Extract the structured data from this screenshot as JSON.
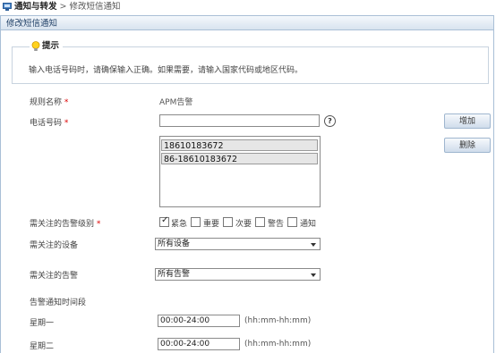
{
  "breadcrumb": {
    "root": "通知与转发",
    "separator": " > ",
    "current": "修改短信通知"
  },
  "panel": {
    "title": "修改短信通知"
  },
  "tip": {
    "title": "提示",
    "text": "输入电话号码时，请确保输入正确。如果需要，请输入国家代码或地区代码。"
  },
  "form": {
    "rule_name": {
      "label": "规则名称",
      "required": "*",
      "value": "APM告警"
    },
    "phone": {
      "label": "电话号码",
      "required": "*",
      "value": "",
      "help": "?"
    },
    "phone_list": [
      "18610183672",
      "86-18610183672"
    ],
    "buttons": {
      "add": "增加",
      "delete": "删除"
    },
    "severity": {
      "label": "需关注的告警级别",
      "required": "*",
      "options": [
        {
          "label": "紧急",
          "checked": true
        },
        {
          "label": "重要",
          "checked": false
        },
        {
          "label": "次要",
          "checked": false
        },
        {
          "label": "警告",
          "checked": false
        },
        {
          "label": "通知",
          "checked": false
        }
      ]
    },
    "device": {
      "label": "需关注的设备",
      "selected": "所有设备"
    },
    "alarm": {
      "label": "需关注的告警",
      "selected": "所有告警"
    },
    "time_section": {
      "label": "告警通知时间段"
    },
    "days": [
      {
        "label": "星期一",
        "value": "00:00-24:00",
        "hint": "(hh:mm-hh:mm)"
      },
      {
        "label": "星期二",
        "value": "00:00-24:00",
        "hint": "(hh:mm-hh:mm)"
      }
    ]
  }
}
